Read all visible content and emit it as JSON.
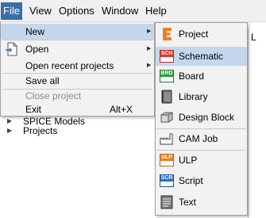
{
  "menubar": {
    "items": [
      {
        "label": "File",
        "active": true
      },
      {
        "label": "View",
        "active": false
      },
      {
        "label": "Options",
        "active": false
      },
      {
        "label": "Window",
        "active": false
      },
      {
        "label": "Help",
        "active": false
      }
    ]
  },
  "background": {
    "tree_rows": [
      "SPICE Models",
      "Projects"
    ],
    "right_pane_letter": "L"
  },
  "file_menu": {
    "new_label": "New",
    "open_label": "Open",
    "open_recent_label": "Open recent projects",
    "save_all_label": "Save all",
    "close_project_label": "Close project",
    "exit_label": "Exit",
    "exit_shortcut": "Alt+X",
    "submenu_arrow": "▶"
  },
  "new_submenu": {
    "items": [
      {
        "label": "Project",
        "icon": "project-icon"
      },
      {
        "label": "Schematic",
        "icon": "schematic-icon",
        "badge": "SCH",
        "highlighted": true
      },
      {
        "label": "Board",
        "icon": "board-icon",
        "badge": "BRD"
      },
      {
        "label": "Library",
        "icon": "library-icon"
      },
      {
        "label": "Design Block",
        "icon": "design-block-icon"
      },
      {
        "label": "CAM Job",
        "icon": "cam-job-icon"
      },
      {
        "label": "ULP",
        "icon": "ulp-icon",
        "badge": "ULP"
      },
      {
        "label": "Script",
        "icon": "script-icon",
        "badge": "SCR"
      },
      {
        "label": "Text",
        "icon": "text-icon"
      }
    ]
  },
  "colors": {
    "menu_active": "#3a6ea5",
    "highlight": "#c5d7ec",
    "eagle_orange": "#f07d1e",
    "sch_red": "#d9362b",
    "brd_green": "#2e9e3e",
    "scr_blue": "#2d6cc0"
  }
}
